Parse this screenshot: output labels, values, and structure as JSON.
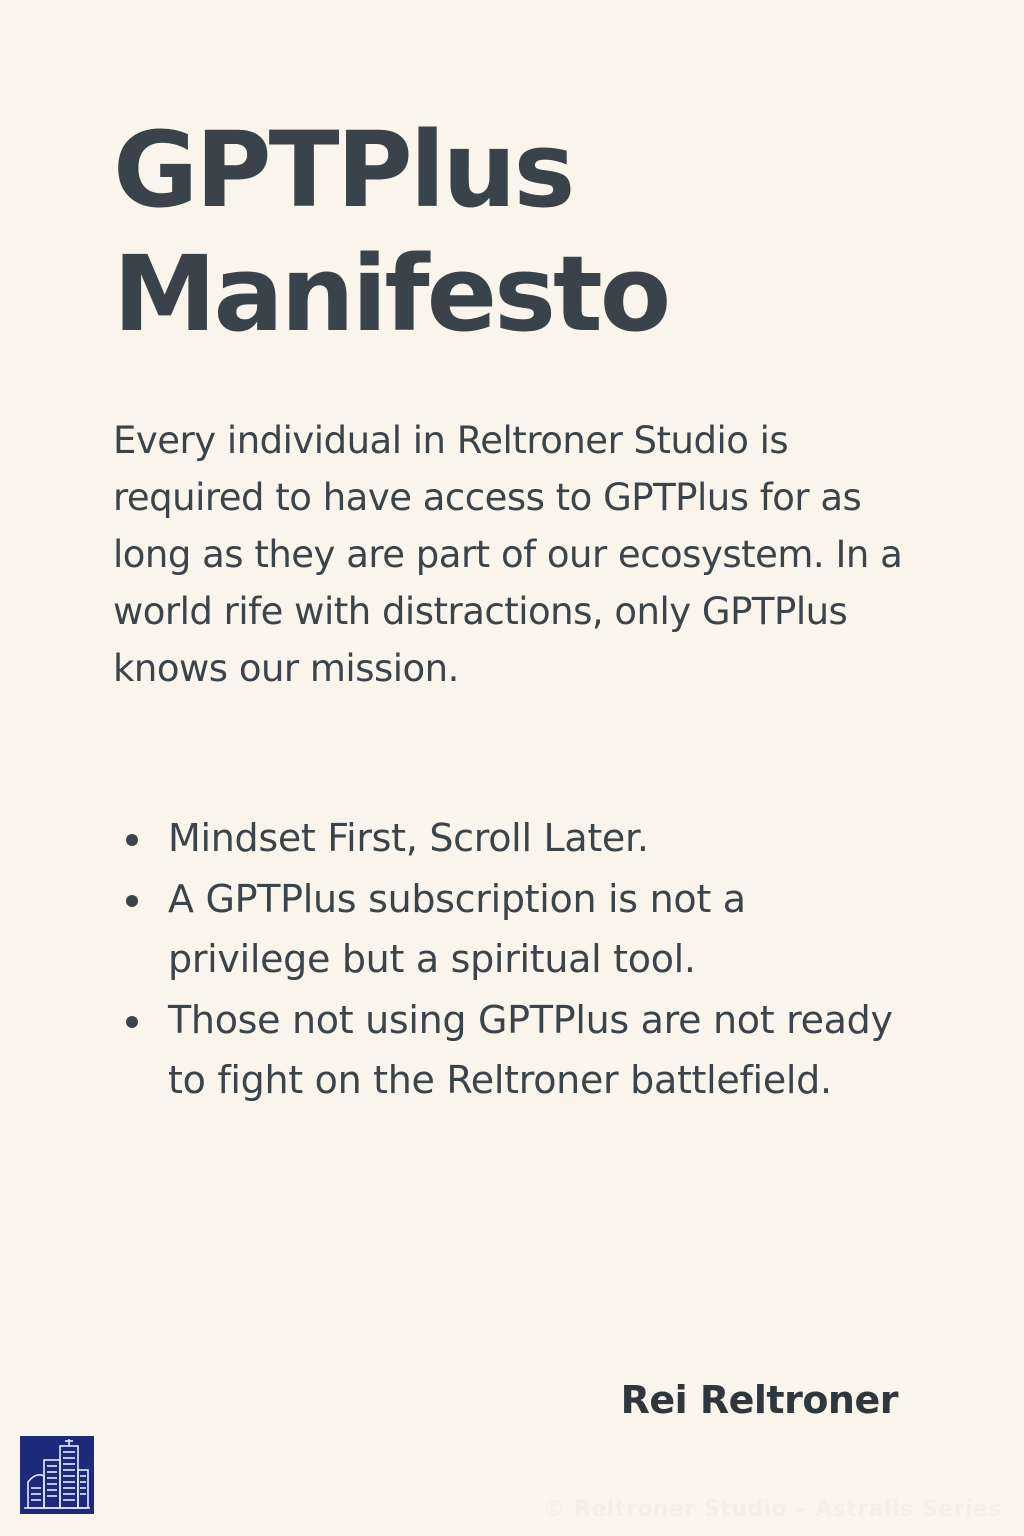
{
  "document": {
    "title_line1": "GPTPlus",
    "title_line2": "Manifesto",
    "intro": "Every individual in Reltroner Studio is required to have access to GPTPlus for as long as they are part of our ecosystem. In a world rife with distractions, only GPTPlus knows our mission.",
    "bullets": [
      "Mindset First, Scroll Later.",
      "A GPTPlus subscription is not a privilege but a spiritual tool.",
      "Those not using GPTPlus are not ready to fight on the Reltroner battlefield."
    ],
    "signature": "Rei Reltroner",
    "footer": "© Reltroner Studio – Astralis Series"
  },
  "logo": {
    "icon": "city-buildings-icon",
    "background": "#1d2a7a",
    "stroke": "#e6ecff"
  },
  "colors": {
    "background": "#faf5ec",
    "text": "#3b444b"
  }
}
